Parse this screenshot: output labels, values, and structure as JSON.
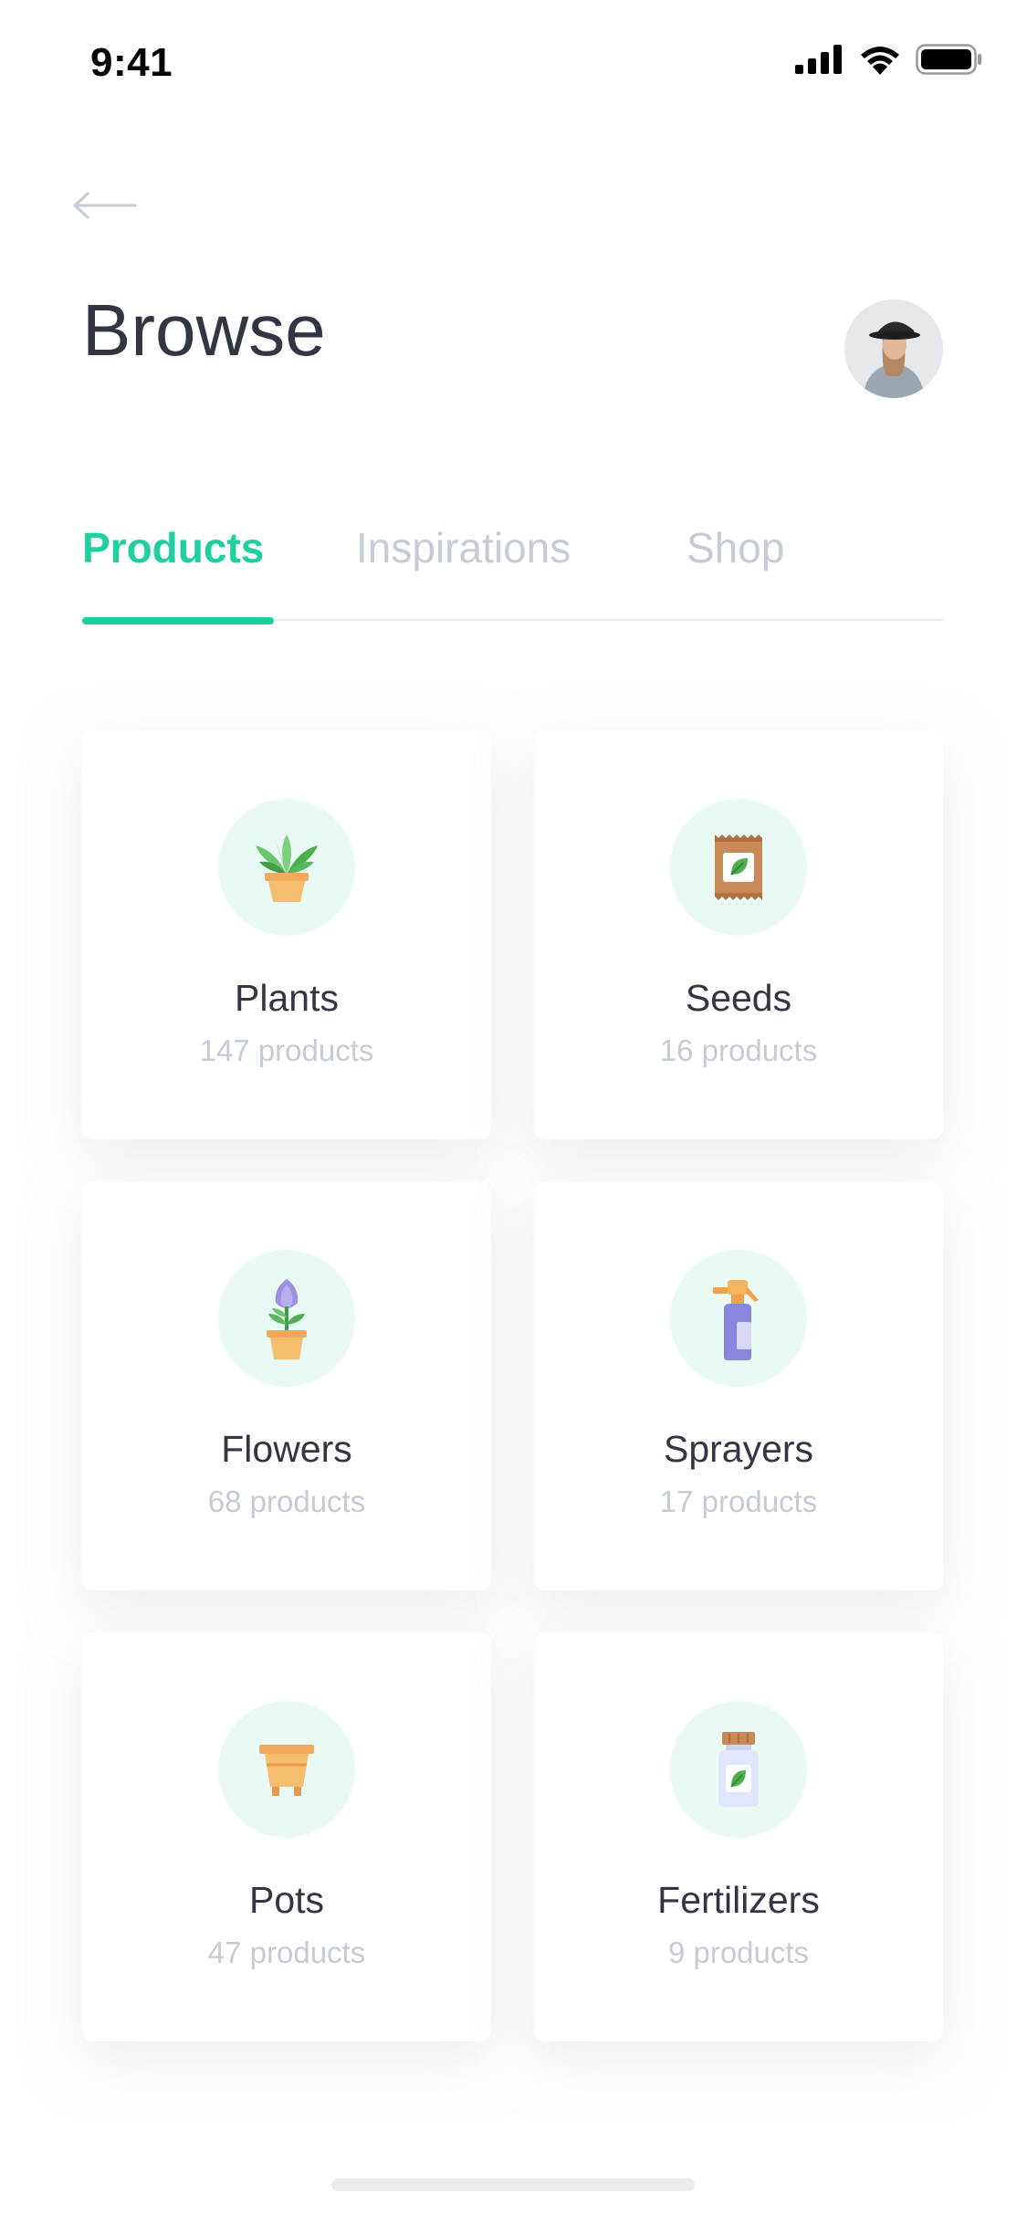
{
  "status_bar": {
    "time": "9:41"
  },
  "header": {
    "title": "Browse",
    "back_icon": "arrow-left-icon"
  },
  "tabs": [
    {
      "label": "Products",
      "active": true
    },
    {
      "label": "Inspirations",
      "active": false
    },
    {
      "label": "Shop",
      "active": false
    }
  ],
  "colors": {
    "accent": "#1ed0a0",
    "title": "#323643",
    "muted": "#c5ccd6",
    "icon_bg": "#e9faf4"
  },
  "categories": [
    {
      "name": "Plants",
      "count": "147 products",
      "icon": "plant-icon"
    },
    {
      "name": "Seeds",
      "count": "16 products",
      "icon": "seed-packet-icon"
    },
    {
      "name": "Flowers",
      "count": "68 products",
      "icon": "flower-icon"
    },
    {
      "name": "Sprayers",
      "count": "17 products",
      "icon": "sprayer-icon"
    },
    {
      "name": "Pots",
      "count": "47 products",
      "icon": "pot-icon"
    },
    {
      "name": "Fertilizers",
      "count": "9 products",
      "icon": "fertilizer-icon"
    }
  ]
}
